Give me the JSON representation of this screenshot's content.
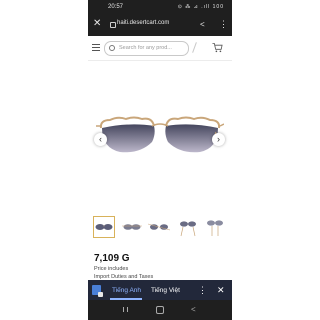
{
  "status_bar": {
    "time": "20:57",
    "icons": "⊙ ⁂ ⊿ .ıll 100"
  },
  "browser": {
    "url": "haiti.desertcart.com",
    "close_icon": "close-icon",
    "share_icon": "share-icon",
    "menu_icon": "more-vert-icon"
  },
  "site_header": {
    "search_placeholder": "Search for any prod..."
  },
  "product": {
    "price": "7,109 G",
    "price_note_line1": "Price includes",
    "price_note_line2": "Import Duties and Taxes",
    "thumbnails": [
      "thumb-1",
      "thumb-2",
      "thumb-3",
      "thumb-4",
      "thumb-5"
    ],
    "selected_thumbnail_index": 0
  },
  "translate_bar": {
    "tab_source": "Tiếng Anh",
    "tab_target": "Tiếng Việt",
    "accent": "#8fb4ff"
  }
}
